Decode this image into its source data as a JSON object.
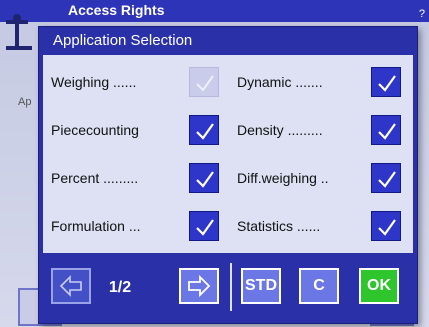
{
  "background": {
    "title": "Access Rights",
    "title_right": "?",
    "left_text": "Ap"
  },
  "dialog": {
    "title": "Application Selection",
    "left_items": [
      {
        "label": "Weighing",
        "dots": "......",
        "checked": true,
        "disabled": true
      },
      {
        "label": "Piececounting",
        "dots": "",
        "checked": true,
        "disabled": false
      },
      {
        "label": "Percent",
        "dots": ".........",
        "checked": true,
        "disabled": false
      },
      {
        "label": "Formulation",
        "dots": "...",
        "checked": true,
        "disabled": false
      }
    ],
    "right_items": [
      {
        "label": "Dynamic",
        "dots": ".......",
        "checked": true,
        "disabled": false
      },
      {
        "label": "Density",
        "dots": ".........",
        "checked": true,
        "disabled": false
      },
      {
        "label": "Diff.weighing",
        "dots": "..",
        "checked": true,
        "disabled": false
      },
      {
        "label": "Statistics",
        "dots": "......",
        "checked": true,
        "disabled": false
      }
    ]
  },
  "footer": {
    "page": "1/2",
    "std_label": "STD",
    "c_label": "C",
    "ok_label": "OK"
  },
  "colors": {
    "dialog_blue": "#2a31a8",
    "check_blue": "#2d36c8",
    "ok_green": "#2ec52d"
  }
}
